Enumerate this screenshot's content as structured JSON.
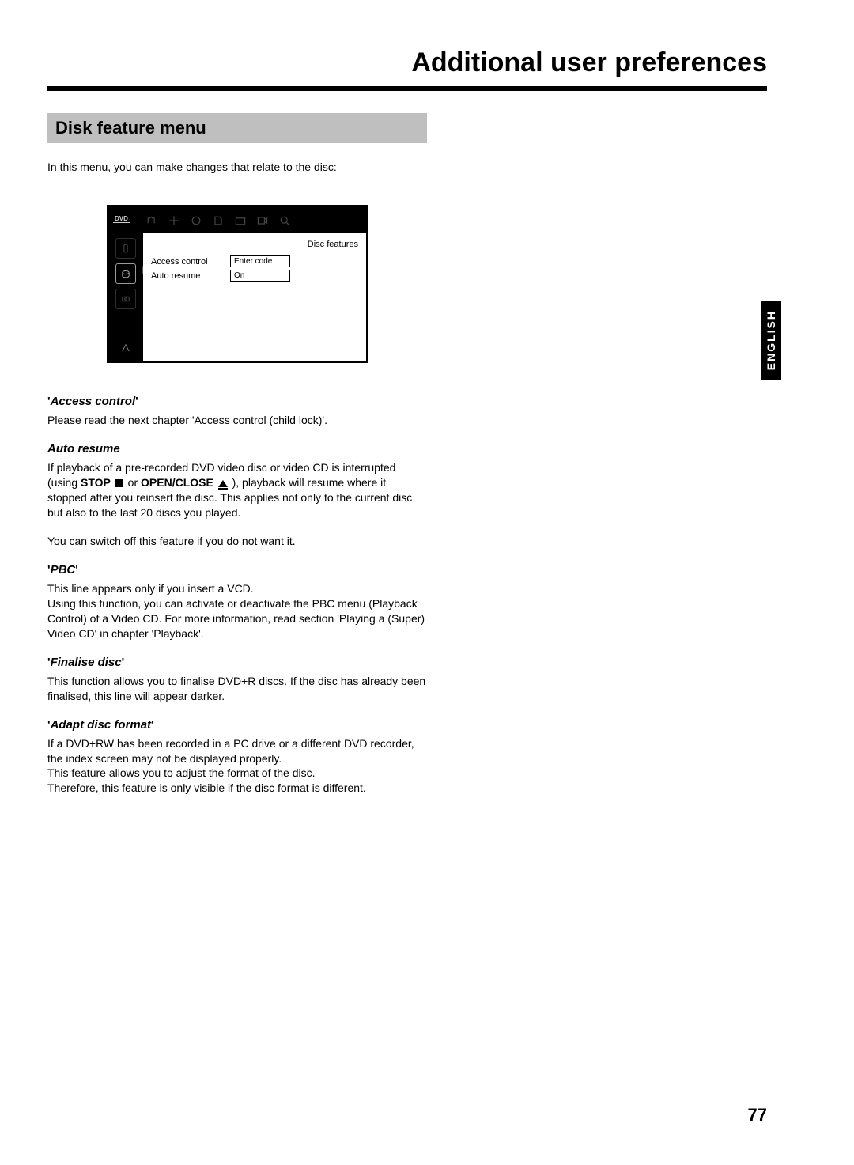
{
  "page_title": "Additional user preferences",
  "section_header": "Disk feature menu",
  "intro": "In this menu, you can make changes that relate to the disc:",
  "osd": {
    "logo": "DVD",
    "heading": "Disc features",
    "rows": [
      {
        "label": "Access control",
        "value": "Enter code"
      },
      {
        "label": "Auto resume",
        "value": "On"
      }
    ]
  },
  "sections": [
    {
      "heading_pre": "'",
      "heading_italic": "Access control",
      "heading_post": "'",
      "paras": [
        "Please read the next chapter 'Access control (child lock)'."
      ]
    },
    {
      "heading_pre": "",
      "heading_italic": "Auto resume",
      "heading_post": "",
      "paras": [
        "__AUTO_RESUME_RICH__",
        "You can switch off this feature if you do not want it."
      ]
    },
    {
      "heading_pre": "'",
      "heading_italic": "PBC",
      "heading_post": "'",
      "paras": [
        "This line appears only if you insert a VCD.\nUsing this function, you can activate or deactivate the PBC menu (Playback Control) of a Video CD. For more information, read section 'Playing a (Super) Video CD' in chapter 'Playback'."
      ]
    },
    {
      "heading_pre": "'",
      "heading_italic": "Finalise disc",
      "heading_post": "'",
      "paras": [
        "This function allows you to finalise DVD+R discs. If the disc has already been finalised, this line will appear darker."
      ]
    },
    {
      "heading_pre": "'",
      "heading_italic": "Adapt disc format",
      "heading_post": "'",
      "paras": [
        "If a DVD+RW has been recorded in a PC drive or a different DVD recorder, the index screen may not be displayed properly.\nThis feature allows you to adjust the format of the disc.\nTherefore, this feature is only visible if the disc format is different."
      ]
    }
  ],
  "auto_resume_rich": {
    "pre": "If playback of a pre-recorded DVD video disc or video CD is interrupted (using ",
    "kw1": "STOP",
    "mid1": " or ",
    "kw2": "OPEN/CLOSE",
    "post": " ), playback will resume where it stopped after you reinsert the disc. This applies not only to the current disc but also to the last 20 discs you played."
  },
  "language_tab": "ENGLISH",
  "page_number": "77"
}
